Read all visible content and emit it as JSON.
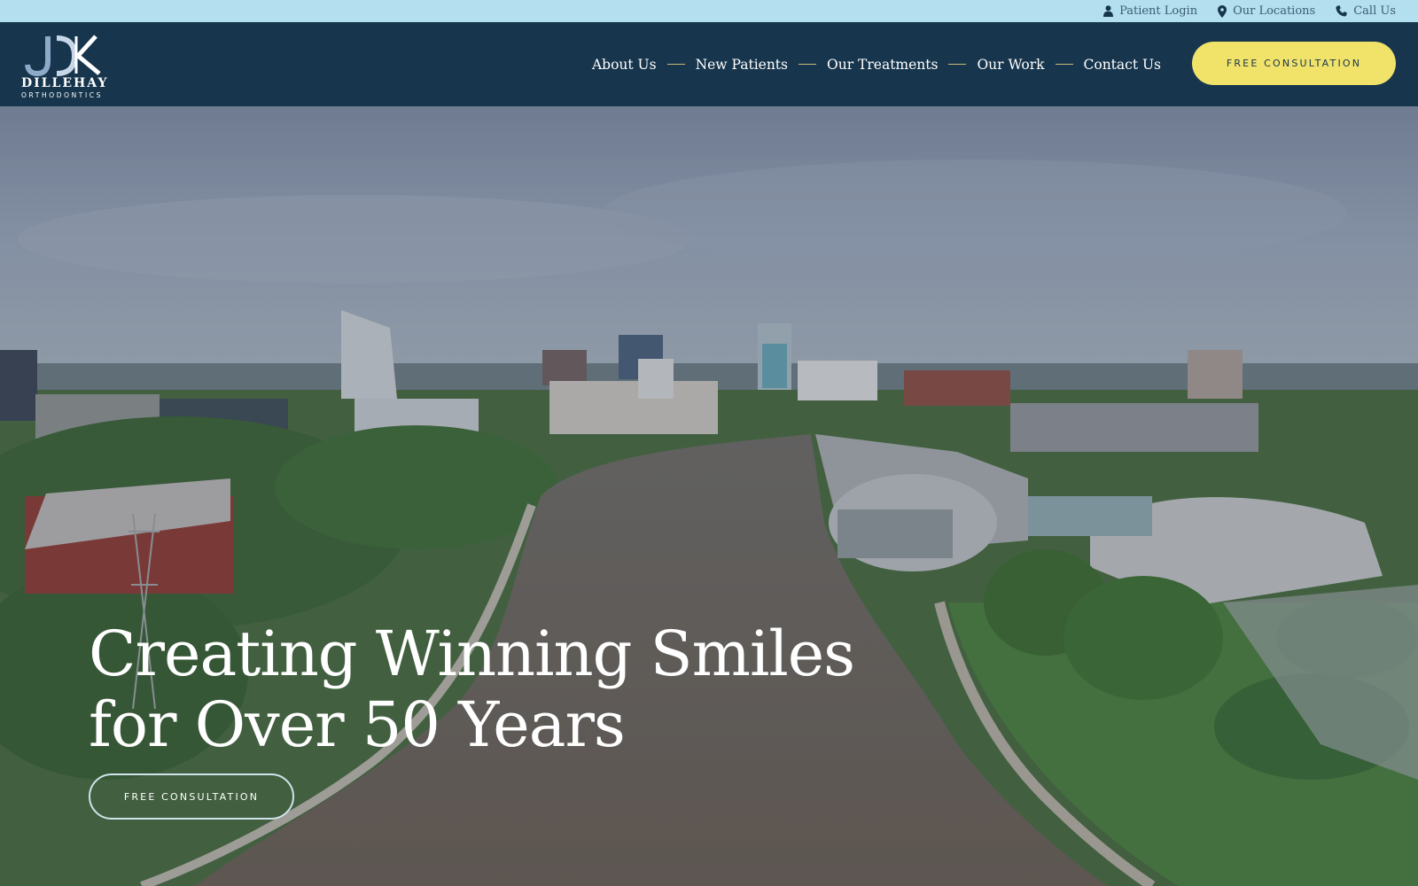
{
  "utility_bar": {
    "patient_login": "Patient Login",
    "locations": "Our Locations",
    "call": "Call Us"
  },
  "logo": {
    "name": "DILLEHAY",
    "tagline": "ORTHODONTICS"
  },
  "nav": {
    "items": [
      "About Us",
      "New Patients",
      "Our Treatments",
      "Our Work",
      "Contact Us"
    ]
  },
  "header_cta": "FREE CONSULTATION",
  "hero": {
    "title_line1": "Creating Winning Smiles",
    "title_line2": "for Over 50 Years",
    "cta": "FREE CONSULTATION"
  },
  "colors": {
    "utility_bar_bg": "#b3dfee",
    "header_bg": "#17364d",
    "accent_yellow": "#f1e26a",
    "nav_separator": "#c9b97a"
  },
  "icons": {
    "patient_login": "user-icon",
    "locations": "map-pin-icon",
    "call": "phone-icon"
  }
}
